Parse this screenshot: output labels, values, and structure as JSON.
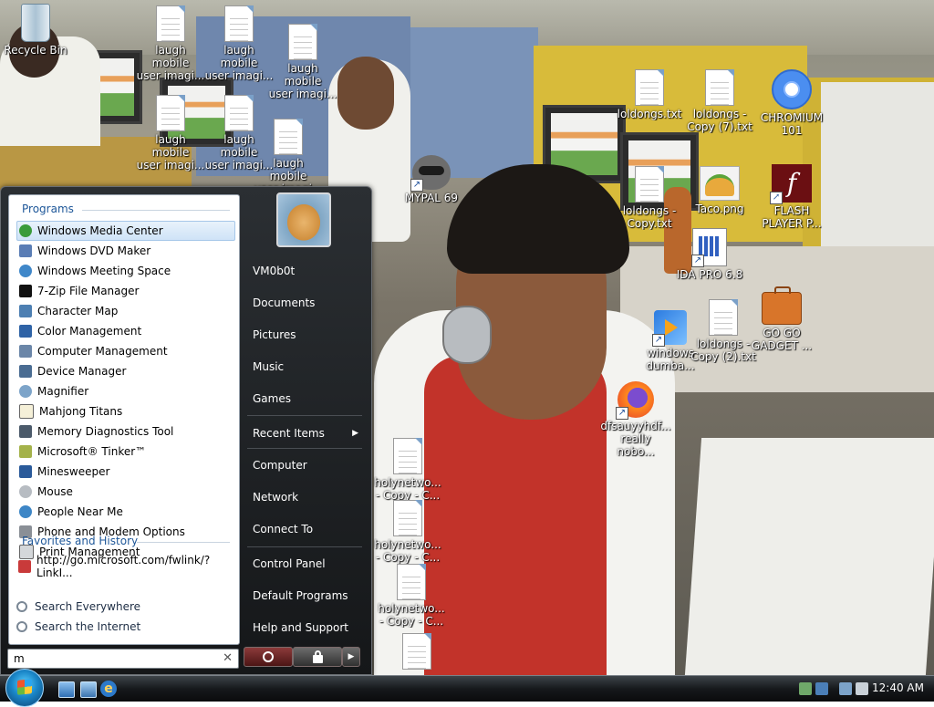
{
  "desktop": {
    "icons": [
      {
        "label": "Recycle Bin"
      },
      {
        "label": "laugh mobile\nuser imagi..."
      },
      {
        "label": "laugh mobile\nuser imagi..."
      },
      {
        "label": "laugh mobile\nuser imagi..."
      },
      {
        "label": "laugh mobile\nuser imagi..."
      },
      {
        "label": "laugh mobile\nuser imagi..."
      },
      {
        "label": "laugh mobile\nuser imagi..."
      },
      {
        "label": "loldongs.txt"
      },
      {
        "label": "loldongs -\nCopy (7).txt"
      },
      {
        "label": "CHROMIUM\n101"
      },
      {
        "label": "MYPAL 69"
      },
      {
        "label": "loldongs -\nCopy.txt"
      },
      {
        "label": "Taco.png"
      },
      {
        "label": "FLASH\nPLAYER P..."
      },
      {
        "label": "IDA PRO 6.8"
      },
      {
        "label": "windows\ndumba..."
      },
      {
        "label": "loldongs -\nCopy (2).txt"
      },
      {
        "label": "GO GO\nGADGET ..."
      },
      {
        "label": "dfsauyyhdf...\nreally nobo..."
      },
      {
        "label": "holynetwo...\n- Copy - C..."
      },
      {
        "label": "holynetwo...\n- Copy - C..."
      },
      {
        "label": "holynetwo...\n- Copy - C..."
      }
    ]
  },
  "start_menu": {
    "programs_title": "Programs",
    "programs": [
      "Windows Media Center",
      "Windows DVD Maker",
      "Windows Meeting Space",
      "7-Zip File Manager",
      "Character Map",
      "Color Management",
      "Computer Management",
      "Device Manager",
      "Magnifier",
      "Mahjong Titans",
      "Memory Diagnostics Tool",
      "Microsoft® Tinker™",
      "Minesweeper",
      "Mouse",
      "People Near Me",
      "Phone and Modem Options",
      "Print Management"
    ],
    "favorites_title": "Favorites and History",
    "favorites": [
      "http://go.microsoft.com/fwlink/?LinkI..."
    ],
    "search_everywhere": "Search Everywhere",
    "search_internet": "Search the Internet",
    "search_query": "m",
    "clear_glyph": "✕",
    "user_name": "VM0b0t",
    "right_items": [
      "Documents",
      "Pictures",
      "Music",
      "Games",
      "Recent Items",
      "Computer",
      "Network",
      "Connect To",
      "Control Panel",
      "Default Programs",
      "Help and Support"
    ],
    "submenu_arrow": "▶",
    "more_arrow": "▶"
  },
  "taskbar": {
    "clock": "12:40 AM",
    "ie_glyph": "e"
  }
}
